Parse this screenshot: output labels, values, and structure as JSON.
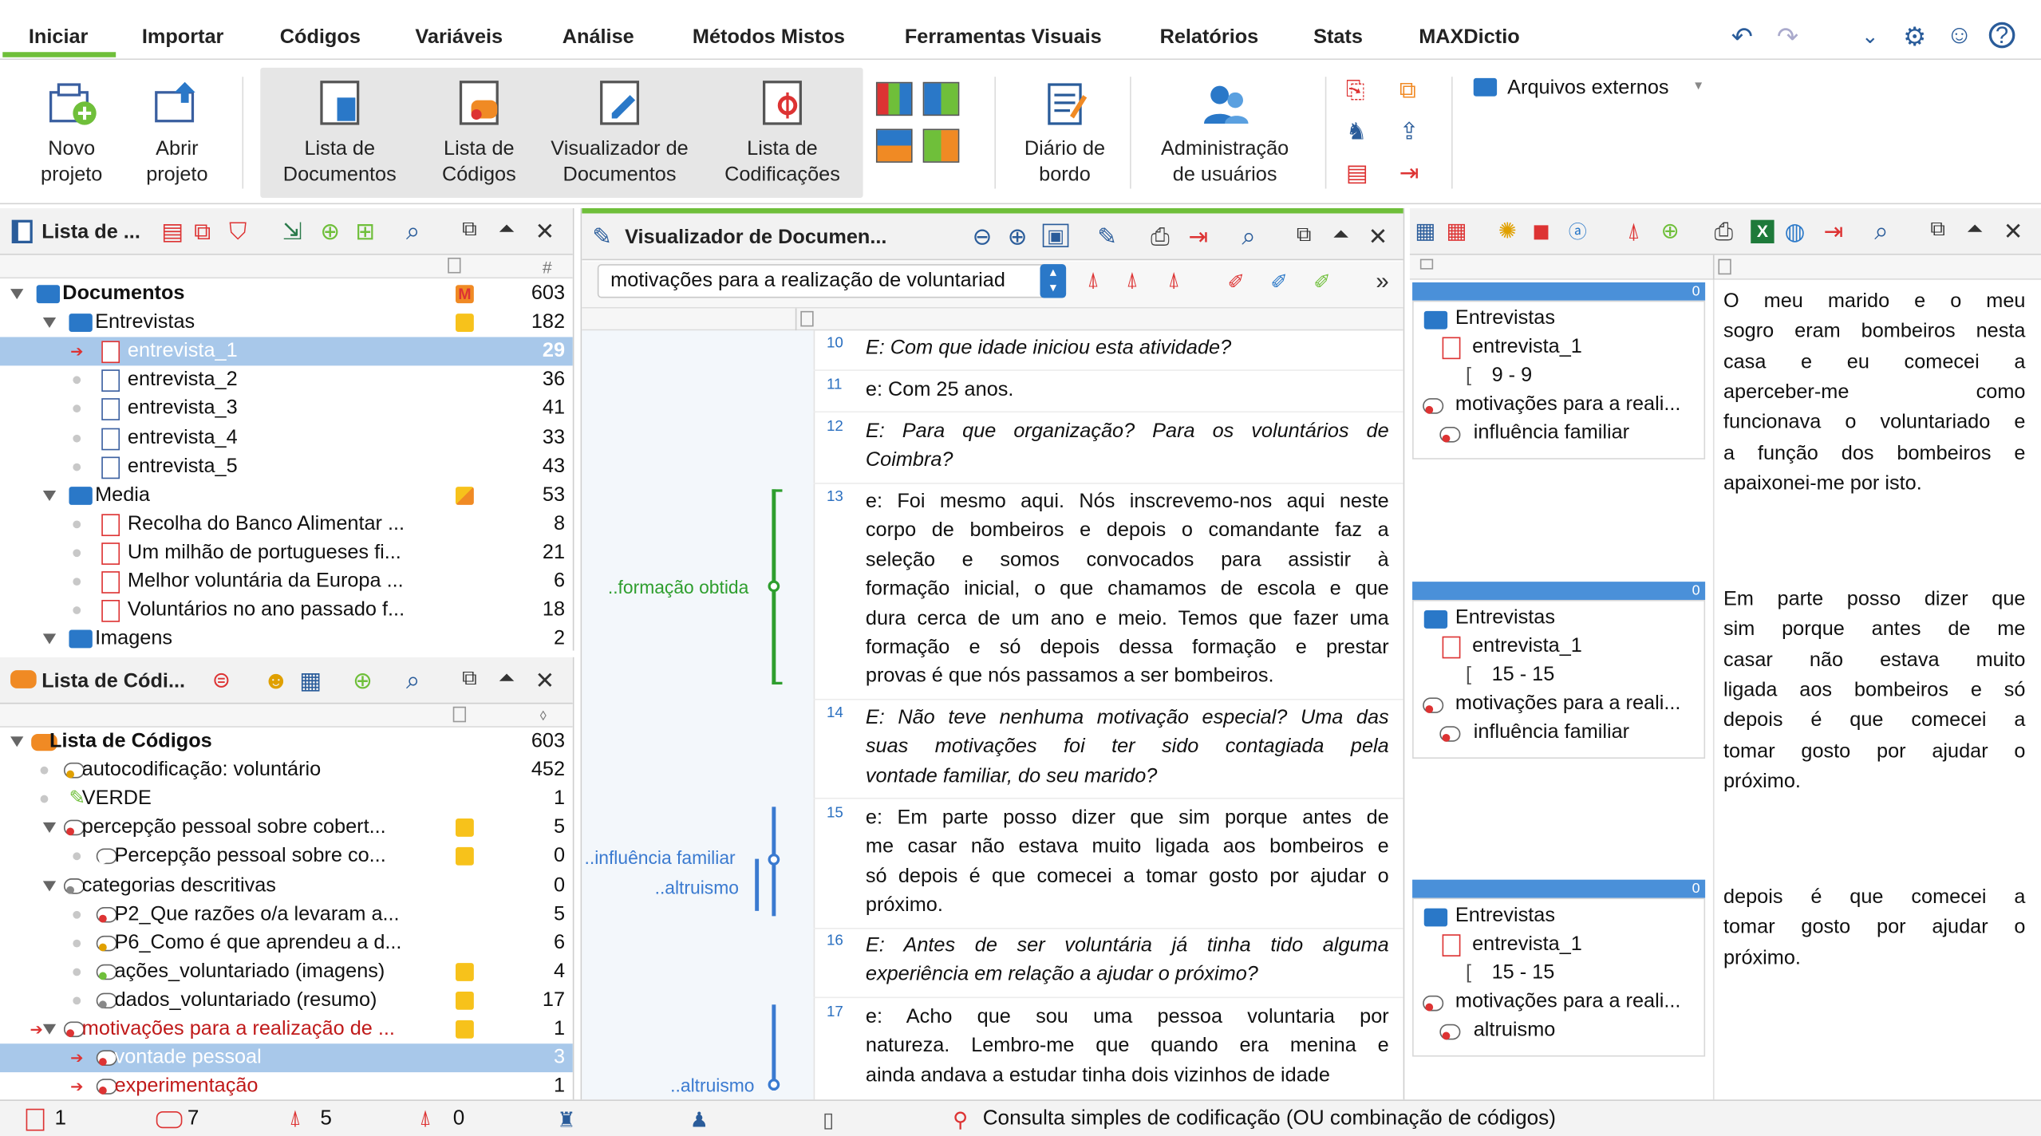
{
  "ribbon_tabs": [
    "Iniciar",
    "Importar",
    "Códigos",
    "Variáveis",
    "Análise",
    "Métodos Mistos",
    "Ferramentas Visuais",
    "Relatórios",
    "Stats",
    "MAXDictio"
  ],
  "ribbon": {
    "novo_projeto": [
      "Novo",
      "projeto"
    ],
    "abrir_projeto": [
      "Abrir",
      "projeto"
    ],
    "lista_documentos": [
      "Lista de",
      "Documentos"
    ],
    "lista_codigos": [
      "Lista de",
      "Códigos"
    ],
    "visualizador": [
      "Visualizador de",
      "Documentos"
    ],
    "lista_codificacoes": [
      "Lista de",
      "Codificações"
    ],
    "diario": [
      "Diário de",
      "bordo"
    ],
    "admin": [
      "Administração",
      "de usuários"
    ],
    "arquivos_externos": "Arquivos externos"
  },
  "doc_panel": {
    "title": "Lista de ...",
    "col_hash": "#",
    "rows": [
      {
        "label": "Documentos",
        "count": "603"
      },
      {
        "label": "Entrevistas",
        "count": "182"
      },
      {
        "label": "entrevista_1",
        "count": "29"
      },
      {
        "label": "entrevista_2",
        "count": "36"
      },
      {
        "label": "entrevista_3",
        "count": "41"
      },
      {
        "label": "entrevista_4",
        "count": "33"
      },
      {
        "label": "entrevista_5",
        "count": "43"
      },
      {
        "label": "Media",
        "count": "53"
      },
      {
        "label": "Recolha do Banco Alimentar ...",
        "count": "8"
      },
      {
        "label": "Um milhão de portugueses fi...",
        "count": "21"
      },
      {
        "label": "Melhor voluntária da Europa ...",
        "count": "6"
      },
      {
        "label": "Voluntários no ano passado f...",
        "count": "18"
      },
      {
        "label": "Imagens",
        "count": "2"
      }
    ],
    "memo_letter": "M"
  },
  "code_panel": {
    "title": "Lista de Códi...",
    "rows": [
      {
        "label": "Lista de Códigos",
        "count": "603"
      },
      {
        "label": "autocodificação: voluntário",
        "count": "452"
      },
      {
        "label": "VERDE",
        "count": "1"
      },
      {
        "label": "percepção pessoal sobre cobert...",
        "count": "5"
      },
      {
        "label": "Percepção pessoal sobre co...",
        "count": "0"
      },
      {
        "label": "categorias descritivas",
        "count": "0"
      },
      {
        "label": "P2_Que razões o/a levaram a...",
        "count": "5"
      },
      {
        "label": "P6_Como é que aprendeu a d...",
        "count": "6"
      },
      {
        "label": "ações_voluntariado (imagens)",
        "count": "4"
      },
      {
        "label": "dados_voluntariado (resumo)",
        "count": "17"
      },
      {
        "label": "motivações para a realização de ...",
        "count": "1"
      },
      {
        "label": "vontade pessoal",
        "count": "3"
      },
      {
        "label": "experimentação",
        "count": "1"
      }
    ]
  },
  "viewer": {
    "title": "Visualizador de Documen...",
    "dropdown": "motivações para a realização de voluntariad",
    "margin_codes": [
      "..formação obtida",
      "..influência familiar",
      "..altruismo",
      "..altruismo"
    ],
    "paragraphs": [
      {
        "n": "10",
        "italic": true,
        "lines": [
          "E: Com que idade iniciou esta atividade?"
        ]
      },
      {
        "n": "11",
        "italic": false,
        "lines": [
          "e: Com 25 anos."
        ]
      },
      {
        "n": "12",
        "italic": true,
        "lines": [
          "E: Para que organização? Para os voluntários de",
          "Coimbra?"
        ]
      },
      {
        "n": "13",
        "italic": false,
        "lines": [
          "e: Foi mesmo aqui. Nós inscrevemo-nos aqui neste",
          "corpo de bombeiros e depois o comandante faz a",
          "seleção e somos convocados para assistir à",
          "formação inicial, o que chamamos de escola e que",
          "dura cerca de um ano e meio. Temos que fazer uma",
          "formação e só depois dessa formação e prestar",
          "provas é que nós passamos a ser bombeiros."
        ]
      },
      {
        "n": "14",
        "italic": true,
        "lines": [
          "E: Não teve nenhuma motivação especial? Uma das",
          "suas motivações foi ter sido contagiada pela",
          "vontade familiar, do seu marido?"
        ]
      },
      {
        "n": "15",
        "italic": false,
        "lines": [
          "e: Em parte posso dizer que sim porque antes de",
          "me casar não estava muito ligada aos bombeiros e",
          "só depois é que comecei a tomar gosto por ajudar o",
          "próximo."
        ]
      },
      {
        "n": "16",
        "italic": true,
        "lines": [
          "E: Antes de ser voluntária já tinha tido alguma",
          "experiência em relação a ajudar o próximo?"
        ]
      },
      {
        "n": "17",
        "italic": false,
        "lines": [
          "e: Acho que sou uma pessoa voluntaria por",
          "natureza. Lembro-me que quando era menina e",
          "ainda andava a estudar tinha dois vizinhos de idade"
        ]
      }
    ]
  },
  "retrieved": {
    "segments": [
      {
        "badge": "0",
        "group": "Entrevistas",
        "doc": "entrevista_1",
        "range": "9 - 9",
        "code": "motivações para a reali...",
        "sub": "influência familiar",
        "text": [
          "O meu marido e o meu",
          "sogro eram bombeiros nesta",
          "casa e eu comecei a",
          "aperceber-me como",
          "funcionava o voluntariado e",
          "a função dos bombeiros e",
          "apaixonei-me por isto."
        ]
      },
      {
        "badge": "0",
        "group": "Entrevistas",
        "doc": "entrevista_1",
        "range": "15 - 15",
        "code": "motivações para a reali...",
        "sub": "influência familiar",
        "text": [
          "Em parte posso dizer que",
          "sim porque antes de me",
          "casar não estava muito",
          "ligada aos bombeiros e só",
          "depois é que comecei a",
          "tomar gosto por ajudar o",
          "próximo."
        ]
      },
      {
        "badge": "0",
        "group": "Entrevistas",
        "doc": "entrevista_1",
        "range": "15 - 15",
        "code": "motivações para a reali...",
        "sub": "altruismo",
        "text": [
          "depois é que comecei a",
          "tomar gosto por ajudar o",
          "próximo."
        ]
      }
    ]
  },
  "status": {
    "docs": "1",
    "codes": "7",
    "codings": "5",
    "other": "0",
    "query": "Consulta simples de codificação (OU combinação de códigos)"
  },
  "colors": {
    "accent": "#6fbf3a",
    "selection": "#a8c8ea",
    "folder": "#2a78c8",
    "blue_header": "#4a90d9",
    "memo_yellow": "#f7c21b"
  }
}
